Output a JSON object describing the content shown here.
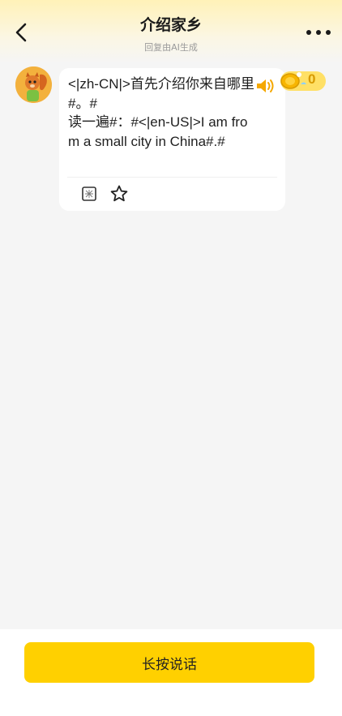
{
  "header": {
    "title": "介绍家乡",
    "subtitle": "回复由AI生成"
  },
  "message": {
    "text": "<|zh-CN|>首先介绍你来自哪里#。#\n读一遍#：#<|en-US|>I am from a small city in China#.#",
    "coins": "0"
  },
  "footer": {
    "talk_button": "长按说话"
  },
  "colors": {
    "accent": "#ffd000",
    "background": "#f5f5f5",
    "header_gradient_top": "#fff2b8",
    "speaker": "#f5a800",
    "coin_text": "#d89a00"
  },
  "icons": {
    "back": "chevron-left-icon",
    "more": "more-dots-icon",
    "speaker": "speaker-icon",
    "coin": "coin-icon",
    "translate": "translate-icon",
    "favorite": "star-outline-icon"
  }
}
